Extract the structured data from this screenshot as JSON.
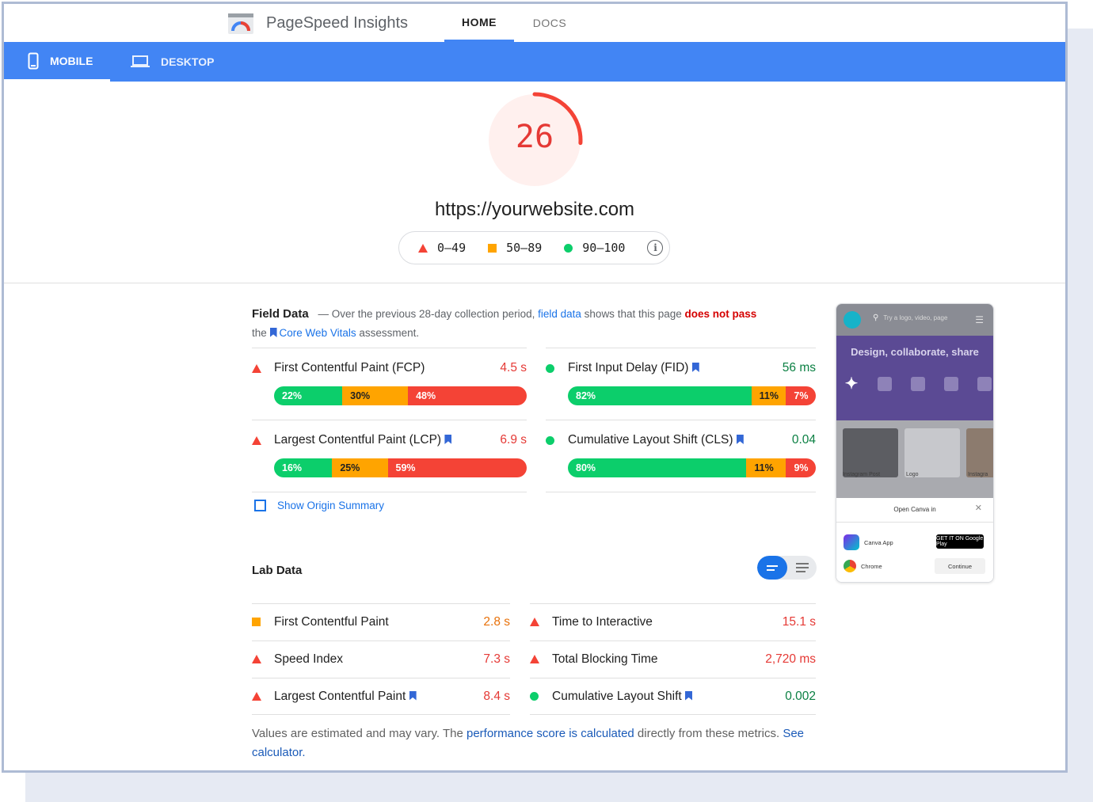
{
  "header": {
    "brand": "PageSpeed Insights",
    "tabs": [
      {
        "label": "HOME",
        "active": true
      },
      {
        "label": "DOCS",
        "active": false
      }
    ]
  },
  "devices": [
    {
      "label": "MOBILE",
      "icon": "smartphone-icon",
      "active": true
    },
    {
      "label": "DESKTOP",
      "icon": "laptop-icon",
      "active": false
    }
  ],
  "summary": {
    "score": "26",
    "score_fraction": 0.26,
    "url": "https://yourwebsite.com",
    "legend": [
      {
        "range": "0–49",
        "icon": "fail-triangle-icon",
        "color": "#f44336"
      },
      {
        "range": "50–89",
        "icon": "average-square-icon",
        "color": "#ffa400"
      },
      {
        "range": "90–100",
        "icon": "pass-circle-icon",
        "color": "#0cce6b"
      }
    ]
  },
  "field_data": {
    "title": "Field Data",
    "desc_prefix": "— Over the previous 28-day collection period,",
    "desc_link": "field data",
    "desc_mid": "shows that this page",
    "desc_fail": "does not pass",
    "desc_the": "the",
    "desc_cwv": "Core Web Vitals",
    "desc_suffix": "assessment.",
    "metrics": [
      {
        "label": "First Contentful Paint (FCP)",
        "value": "4.5 s",
        "status": "fail",
        "cwv": false,
        "dist": [
          "22%",
          "30%",
          "48%"
        ]
      },
      {
        "label": "First Input Delay (FID)",
        "value": "56 ms",
        "status": "pass",
        "cwv": true,
        "dist": [
          "82%",
          "11%",
          "7%"
        ]
      },
      {
        "label": "Largest Contentful Paint (LCP)",
        "value": "6.9 s",
        "status": "fail",
        "cwv": true,
        "dist": [
          "16%",
          "25%",
          "59%"
        ]
      },
      {
        "label": "Cumulative Layout Shift (CLS)",
        "value": "0.04",
        "status": "pass",
        "cwv": true,
        "dist": [
          "80%",
          "11%",
          "9%"
        ]
      }
    ],
    "origin_label": "Show Origin Summary"
  },
  "lab_data": {
    "title": "Lab Data",
    "metrics": [
      {
        "label": "First Contentful Paint",
        "value": "2.8 s",
        "status": "average",
        "cwv": false
      },
      {
        "label": "Time to Interactive",
        "value": "15.1 s",
        "status": "fail",
        "cwv": false
      },
      {
        "label": "Speed Index",
        "value": "7.3 s",
        "status": "fail",
        "cwv": false
      },
      {
        "label": "Total Blocking Time",
        "value": "2,720 ms",
        "status": "fail",
        "cwv": false
      },
      {
        "label": "Largest Contentful Paint",
        "value": "8.4 s",
        "status": "fail",
        "cwv": true
      },
      {
        "label": "Cumulative Layout Shift",
        "value": "0.002",
        "status": "pass",
        "cwv": true
      }
    ],
    "note_prefix": "Values are estimated and may vary. The",
    "note_link": "performance score is calculated",
    "note_mid": "directly from these metrics.",
    "note_link2": "See calculator."
  },
  "thumbnail": {
    "search_placeholder": "Try a logo, video, page",
    "hero_title": "Design, collaborate, share",
    "captions": [
      "Instagram Post",
      "Logo",
      "Instagra"
    ],
    "sheet_title": "Open Canva in",
    "apps": [
      "Canva App",
      "Chrome"
    ],
    "google_play": "GET IT ON Google Play",
    "continue": "Continue"
  },
  "colors": {
    "accent": "#4285f4",
    "fail": "#f44336",
    "average": "#ffa400",
    "pass": "#0cce6b"
  }
}
